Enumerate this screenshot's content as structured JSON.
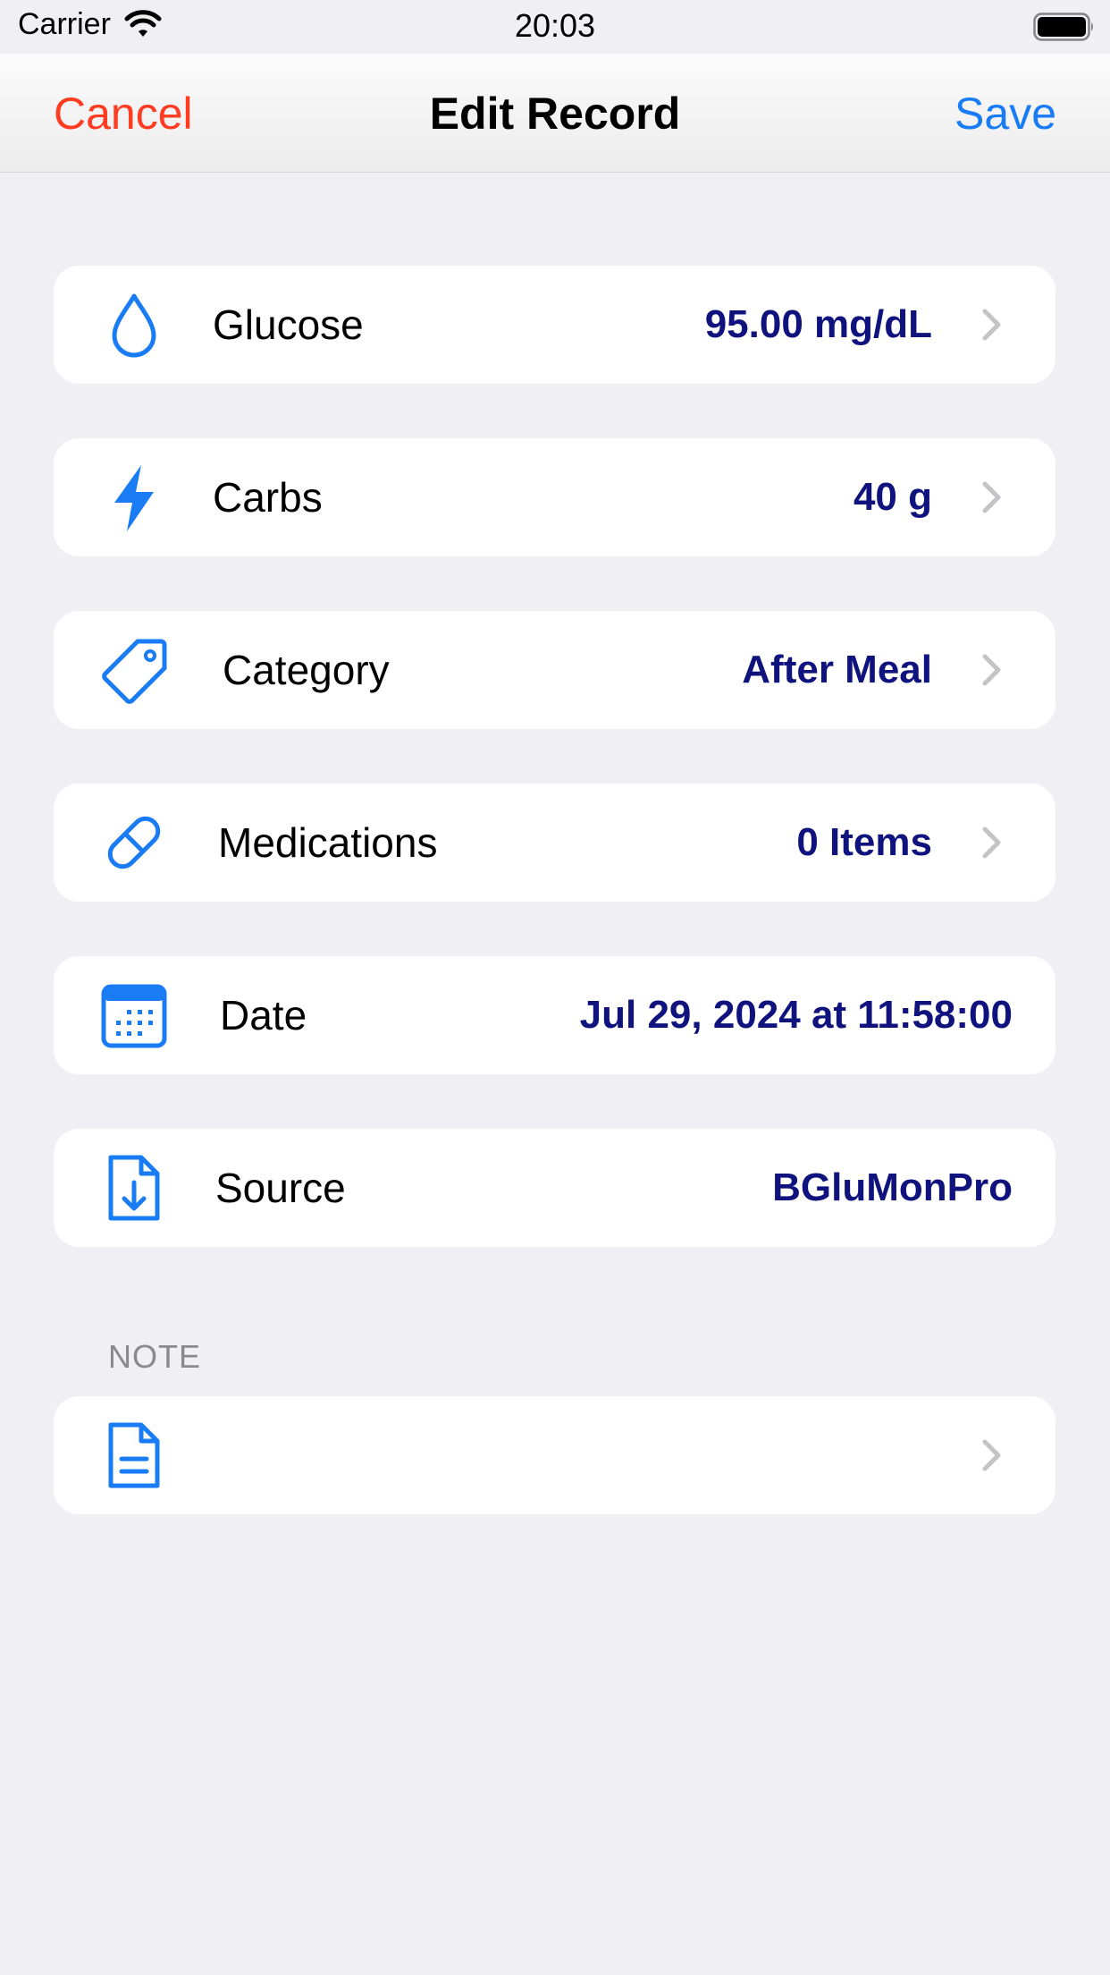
{
  "status_bar": {
    "carrier": "Carrier",
    "time": "20:03"
  },
  "nav": {
    "cancel_label": "Cancel",
    "title": "Edit Record",
    "save_label": "Save"
  },
  "rows": [
    {
      "id": "glucose",
      "icon": "drop-icon",
      "label": "Glucose",
      "value": "95.00 mg/dL",
      "has_chevron": true
    },
    {
      "id": "carbs",
      "icon": "bolt-icon",
      "label": "Carbs",
      "value": "40 g",
      "has_chevron": true
    },
    {
      "id": "category",
      "icon": "tag-icon",
      "label": "Category",
      "value": "After Meal",
      "has_chevron": true
    },
    {
      "id": "medications",
      "icon": "pill-icon",
      "label": "Medications",
      "value": "0 Items",
      "has_chevron": true
    },
    {
      "id": "date",
      "icon": "calendar-icon",
      "label": "Date",
      "value": "Jul 29, 2024 at 11:58:00",
      "has_chevron": false
    },
    {
      "id": "source",
      "icon": "document-download-icon",
      "label": "Source",
      "value": "BGluMonPro",
      "has_chevron": false
    }
  ],
  "note_section": {
    "header": "NOTE",
    "icon": "document-text-icon",
    "value": ""
  },
  "colors": {
    "accent_blue": "#1a7cf5",
    "value_navy": "#10137d",
    "cancel_red": "#ff3b22",
    "background": "#efeff4"
  }
}
